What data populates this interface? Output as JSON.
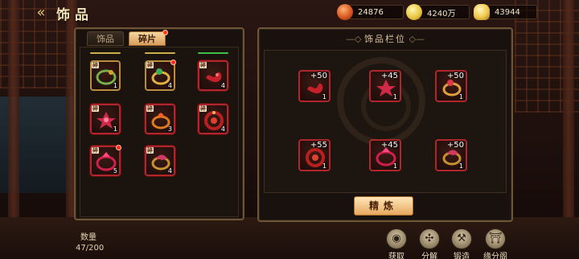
{
  "header": {
    "title": "饰品",
    "back_icon": "double-chevron-left-icon"
  },
  "currencies": [
    {
      "icon": "gem-coin-icon",
      "value": "24876",
      "color": "#d4501c"
    },
    {
      "icon": "gold-coins-icon",
      "value": "4240万",
      "color": "#e8c23a"
    },
    {
      "icon": "gold-ingot-icon",
      "value": "43944",
      "color": "#f0c848"
    }
  ],
  "left_panel": {
    "tabs": [
      {
        "label": "饰品",
        "active": false
      },
      {
        "label": "碎片",
        "active": true,
        "has_alert": true
      }
    ],
    "fragment_tag": "碎",
    "items": [
      {
        "name": "jade-ring",
        "count": "1",
        "quality": "gold",
        "tag": true,
        "alert": false
      },
      {
        "name": "gold-gem-ring",
        "count": "4",
        "quality": "gold",
        "tag": true,
        "alert": true
      },
      {
        "name": "red-ribbon",
        "count": "4",
        "quality": "red",
        "tag": true,
        "alert": false
      },
      {
        "name": "crimson-blossom",
        "count": "1",
        "quality": "red",
        "tag": true,
        "alert": false
      },
      {
        "name": "flame-ring",
        "count": "3",
        "quality": "red",
        "tag": true,
        "alert": false
      },
      {
        "name": "spiral-amulet",
        "count": "4",
        "quality": "red",
        "tag": true,
        "alert": false
      },
      {
        "name": "ruby-bangle",
        "count": "5",
        "quality": "red",
        "tag": true,
        "alert": true
      },
      {
        "name": "dragon-ring",
        "count": "4",
        "quality": "red",
        "tag": true,
        "alert": false
      }
    ]
  },
  "right_panel": {
    "title": "饰品栏位",
    "slots": [
      {
        "name": "ribbon-accessory",
        "plus": "+50",
        "level": "1"
      },
      {
        "name": "crimson-blossom",
        "plus": "+45",
        "level": "1"
      },
      {
        "name": "gold-gem-ring",
        "plus": "+50",
        "level": "1"
      },
      {
        "name": "spiral-amulet",
        "plus": "+55",
        "level": "1"
      },
      {
        "name": "ruby-bangle",
        "plus": "+45",
        "level": "1"
      },
      {
        "name": "dragon-ring",
        "plus": "+50",
        "level": "1"
      }
    ],
    "refine_label": "精炼"
  },
  "footer": {
    "qty_label": "数量",
    "qty_value": "47/200",
    "actions": [
      {
        "label": "获取",
        "icon": "coin-pouch-icon"
      },
      {
        "label": "分解",
        "icon": "decompose-icon"
      },
      {
        "label": "锻造",
        "icon": "hammer-icon"
      },
      {
        "label": "缘分阁",
        "icon": "pavilion-icon"
      }
    ]
  }
}
